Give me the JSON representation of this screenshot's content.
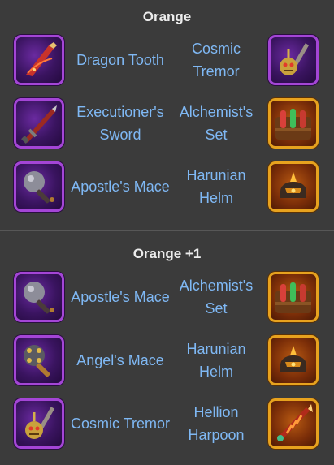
{
  "sections": [
    {
      "title": "Orange",
      "rows": [
        {
          "left": {
            "name": "Dragon Tooth",
            "icon": "dragon-tooth-icon",
            "rarity": "purple"
          },
          "right": {
            "name": "Cosmic Tremor",
            "icon": "cosmic-tremor-icon",
            "rarity": "purple"
          }
        },
        {
          "left": {
            "name": "Executioner's Sword",
            "icon": "executioners-sword-icon",
            "rarity": "purple"
          },
          "right": {
            "name": "Alchemist's Set",
            "icon": "alchemists-set-icon",
            "rarity": "gold"
          }
        },
        {
          "left": {
            "name": "Apostle's Mace",
            "icon": "apostles-mace-icon",
            "rarity": "purple"
          },
          "right": {
            "name": "Harunian Helm",
            "icon": "harunian-helm-icon",
            "rarity": "gold"
          }
        }
      ]
    },
    {
      "title": "Orange +1",
      "rows": [
        {
          "left": {
            "name": "Apostle's Mace",
            "icon": "apostles-mace-icon",
            "rarity": "purple"
          },
          "right": {
            "name": "Alchemist's Set",
            "icon": "alchemists-set-icon",
            "rarity": "gold"
          }
        },
        {
          "left": {
            "name": "Angel's Mace",
            "icon": "angels-mace-icon",
            "rarity": "purple"
          },
          "right": {
            "name": "Harunian Helm",
            "icon": "harunian-helm-icon",
            "rarity": "gold"
          }
        },
        {
          "left": {
            "name": "Cosmic Tremor",
            "icon": "cosmic-tremor-icon",
            "rarity": "purple"
          },
          "right": {
            "name": "Hellion Harpoon",
            "icon": "hellion-harpoon-icon",
            "rarity": "gold"
          }
        }
      ]
    }
  ],
  "colors": {
    "background": "#3b3b3b",
    "title": "#ececec",
    "item_name": "#7fb8f4",
    "purple_frame": "#a445d6",
    "gold_frame": "#e7a21e"
  }
}
